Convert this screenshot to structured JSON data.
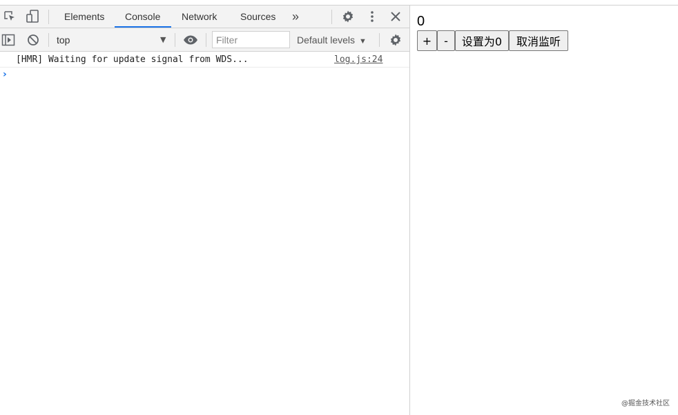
{
  "devtools": {
    "tabs": [
      {
        "label": "Elements"
      },
      {
        "label": "Console",
        "active": true
      },
      {
        "label": "Network"
      },
      {
        "label": "Sources"
      }
    ],
    "more_tabs_symbol": "»",
    "toolbar": {
      "context": "top",
      "filter_placeholder": "Filter",
      "levels": "Default levels"
    },
    "console": {
      "messages": [
        {
          "text": "[HMR] Waiting for update signal from WDS...",
          "source": "log.js:24"
        }
      ],
      "prompt": "›"
    },
    "colors": {
      "accent": "#1a73e8",
      "toolbar_bg": "#f3f3f3"
    }
  },
  "page": {
    "counter": "0",
    "buttons": {
      "increment": "+",
      "decrement": "-",
      "reset": "设置为0",
      "unwatch": "取消监听"
    }
  },
  "watermark": "@掘金技术社区"
}
